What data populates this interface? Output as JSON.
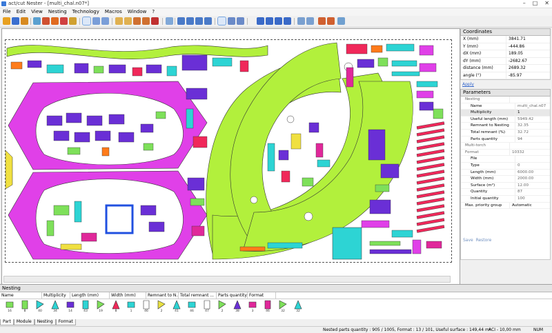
{
  "window": {
    "title": "act/cut Nester - [multi_chal.n07*]",
    "min": "–",
    "max": "□",
    "close": "✕"
  },
  "menu": {
    "items": [
      "File",
      "Edit",
      "View",
      "Nesting",
      "Technology",
      "Macros",
      "Window",
      "?"
    ]
  },
  "mdi_controls": {
    "min": "–",
    "max": "▫",
    "close": "✕"
  },
  "coordinates": {
    "title": "Coordinates",
    "rows": [
      {
        "label": "X (mm)",
        "value": "3841.71"
      },
      {
        "label": "Y (mm)",
        "value": "-444.86"
      },
      {
        "label": "dX (mm)",
        "value": "189.05"
      },
      {
        "label": "dY (mm)",
        "value": "-2682.67"
      },
      {
        "label": "distance (mm)",
        "value": "2689.32"
      },
      {
        "label": "angle (°)",
        "value": "-85.97"
      }
    ],
    "apply": "Apply"
  },
  "parameters": {
    "title": "Parameters",
    "rows": [
      {
        "label": "Nesting",
        "value": "",
        "indent": 0,
        "type": "grp"
      },
      {
        "label": "Name",
        "value": "multi_chal.n07",
        "indent": 1,
        "type": ""
      },
      {
        "label": "Multiplicity",
        "value": "1",
        "indent": 1,
        "type": "bold hl"
      },
      {
        "label": "Useful length (mm)",
        "value": "5949.42",
        "indent": 1,
        "type": ""
      },
      {
        "label": "Remnant to Nesting",
        "value": "32.35",
        "indent": 1,
        "type": ""
      },
      {
        "label": "Total remnant (%)",
        "value": "32.72",
        "indent": 1,
        "type": ""
      },
      {
        "label": "Parts quantity",
        "value": "94",
        "indent": 1,
        "type": ""
      },
      {
        "label": "Multi-torch",
        "value": "",
        "indent": 0,
        "type": "grp"
      },
      {
        "label": "Format",
        "value": "10332",
        "indent": 0,
        "type": "grp"
      },
      {
        "label": "File",
        "value": "",
        "indent": 1,
        "type": ""
      },
      {
        "label": "Type",
        "value": "0",
        "indent": 1,
        "type": ""
      },
      {
        "label": "Length (mm)",
        "value": "6000.00",
        "indent": 1,
        "type": ""
      },
      {
        "label": "Width (mm)",
        "value": "2000.00",
        "indent": 1,
        "type": ""
      },
      {
        "label": "Surface (m²)",
        "value": "12.00",
        "indent": 1,
        "type": ""
      },
      {
        "label": "Quantity",
        "value": "87",
        "indent": 1,
        "type": ""
      },
      {
        "label": "Initial quantity",
        "value": "100",
        "indent": 1,
        "type": ""
      },
      {
        "label": "Max. priority group",
        "value": "Automatic",
        "indent": 0,
        "type": "bold"
      }
    ],
    "save": "Save",
    "restore": "Restore"
  },
  "nesting_panel": {
    "title": "Nesting",
    "columns": [
      "Name",
      "Multiplicity",
      "Length (mm)",
      "Width (mm)",
      "Remnant to N...",
      "Total remnant ...",
      "Parts quantity",
      "Format"
    ],
    "parts": [
      {
        "qty": "16",
        "color": "#7ee05a"
      },
      {
        "qty": "8",
        "color": "#7ee05a"
      },
      {
        "qty": "40",
        "color": "#2dd4d4"
      },
      {
        "qty": "34",
        "color": "#2dd4d4"
      },
      {
        "qty": "14",
        "color": "#6a2fd6"
      },
      {
        "qty": "43",
        "color": "#2dd4d4"
      },
      {
        "qty": "19",
        "color": "#7ee05a"
      },
      {
        "qty": "8",
        "color": "#f0285a"
      },
      {
        "qty": "1",
        "color": "#2dd4d4"
      },
      {
        "qty": "46",
        "color": "#ffffff"
      },
      {
        "qty": "2",
        "color": "#e8e040"
      },
      {
        "qty": "41",
        "color": "#2dd4d4"
      },
      {
        "qty": "46",
        "color": "#2dd4d4"
      },
      {
        "qty": "47",
        "color": "#ffffff"
      },
      {
        "qty": "2",
        "color": "#7ee05a"
      },
      {
        "qty": "38",
        "color": "#6a2fd6"
      },
      {
        "qty": "3",
        "color": "#e0289a"
      },
      {
        "qty": "46",
        "color": "#e0289a"
      },
      {
        "qty": "32",
        "color": "#7ee05a"
      },
      {
        "qty": "32",
        "color": "#2dd4d4"
      }
    ]
  },
  "bottom_tabs": [
    "Part",
    "Module",
    "Nesting",
    "Format"
  ],
  "status": {
    "summary": "Nested parts quantity : 905 / 1005, Format : 13 / 101, Useful surface : 149,44 m²",
    "technology": "ACI - 10,00 mm",
    "num": "NUM"
  },
  "colors": {
    "magenta": "#e040e8",
    "lime": "#b2f03c",
    "violet": "#6a2fd6",
    "cyan": "#2dd4d4",
    "pink": "#f0285a",
    "orange": "#ff7b1a",
    "yellow": "#f0e040",
    "blue": "#2050e0"
  }
}
